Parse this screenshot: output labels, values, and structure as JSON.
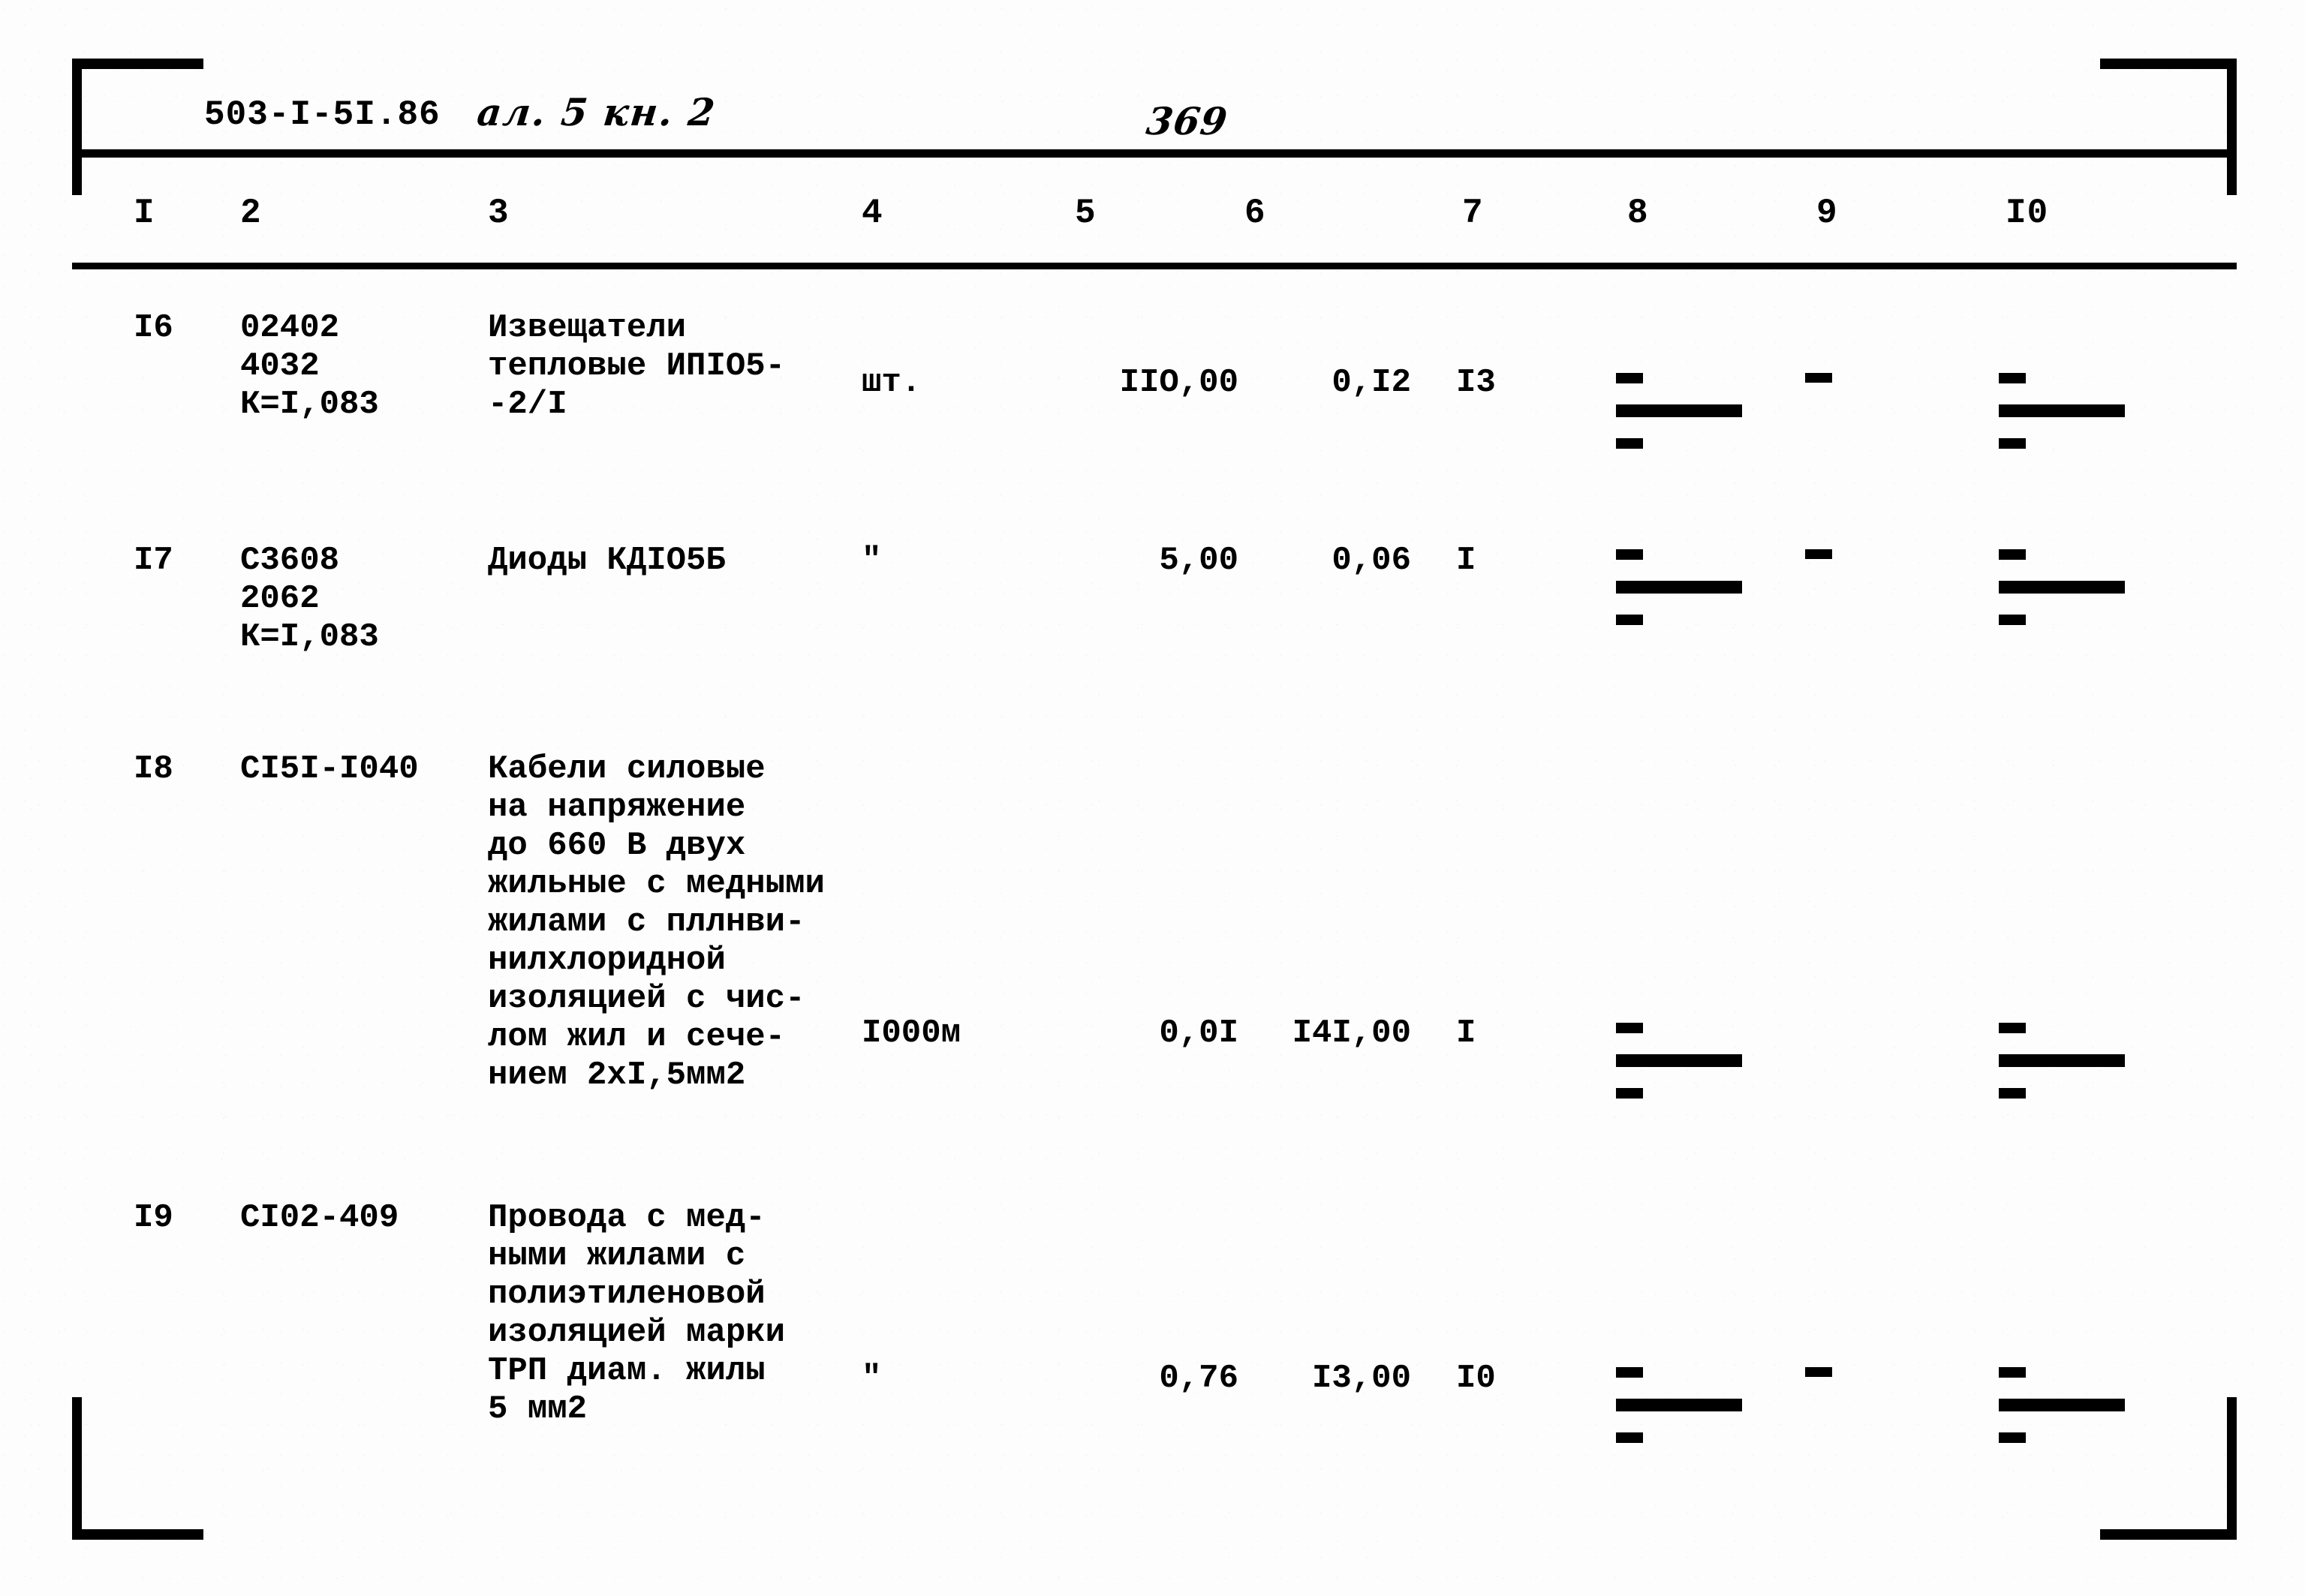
{
  "header": {
    "doc_code": "503-I-5I.86",
    "album_book": "ал. 5 кн. 2",
    "page_number": "369"
  },
  "column_numbers": [
    "I",
    "2",
    "3",
    "4",
    "5",
    "6",
    "7",
    "8",
    "9",
    "I0"
  ],
  "rows": [
    {
      "num": "I6",
      "code": "02402\n4032\nК=I,083",
      "description": "Извещатели\nтепловые ИПIО5-\n-2/I",
      "unit": "шт.",
      "qty": "IIO,00",
      "price": "0,I2",
      "col7": "I3",
      "col8": "frac",
      "col9": "dash",
      "col10": "frac"
    },
    {
      "num": "I7",
      "code": "С3608\n2062\nК=I,083",
      "description": "Диоды КДIО5Б",
      "unit": "\"",
      "qty": "5,00",
      "price": "0,06",
      "col7": "I",
      "col8": "frac",
      "col9": "dash",
      "col10": "frac"
    },
    {
      "num": "I8",
      "code": "СI5I-I040",
      "description": "Кабели силовые\nна напряжение\nдо 660 В двух\nжильные с медными\nжилами с пллнви-\nнилхлоридной\nизоляцией с чис-\nлом жил и сече-\nнием 2xI,5мм2",
      "unit": "I000м",
      "qty": "0,0I",
      "price": "I4I,00",
      "col7": "I",
      "col8": "frac",
      "col9": "",
      "col10": "frac"
    },
    {
      "num": "I9",
      "code": "СI02-409",
      "description": "Провода с мед-\nными жилами с\nполиэтиленовой\nизоляцией марки\nТРП диам. жилы\n5 мм2",
      "unit": "\"",
      "qty": "0,76",
      "price": "I3,00",
      "col7": "I0",
      "col8": "frac",
      "col9": "dash",
      "col10": "frac"
    }
  ]
}
